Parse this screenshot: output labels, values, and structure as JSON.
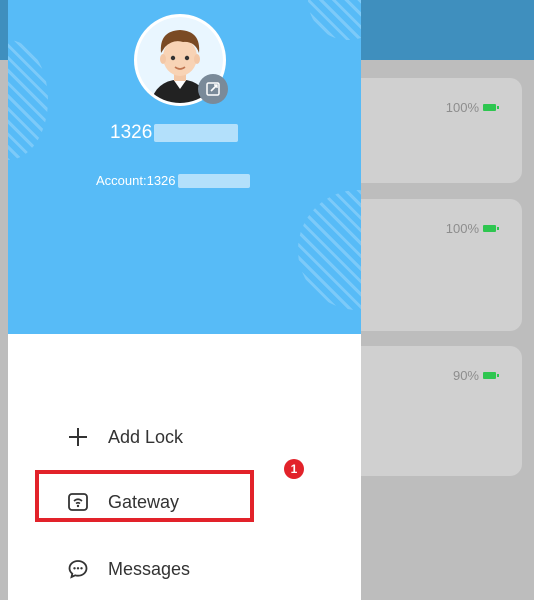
{
  "background_app": {
    "cards": [
      {
        "battery": "100%"
      },
      {
        "battery": "100%"
      },
      {
        "battery": "90%"
      }
    ],
    "battery_color": "#2ec650"
  },
  "drawer": {
    "header_color": "#57bbf7",
    "username": "1326",
    "account_label": "Account:1326",
    "avatar_icon": "avatar",
    "edit_icon": "edit-icon",
    "menu": {
      "add_lock": {
        "label": "Add Lock",
        "icon": "plus-icon"
      },
      "gateway": {
        "label": "Gateway",
        "icon": "gateway-icon"
      },
      "messages": {
        "label": "Messages",
        "icon": "message-icon"
      }
    }
  },
  "annotation": {
    "step_number": "1",
    "color": "#e2222a"
  }
}
